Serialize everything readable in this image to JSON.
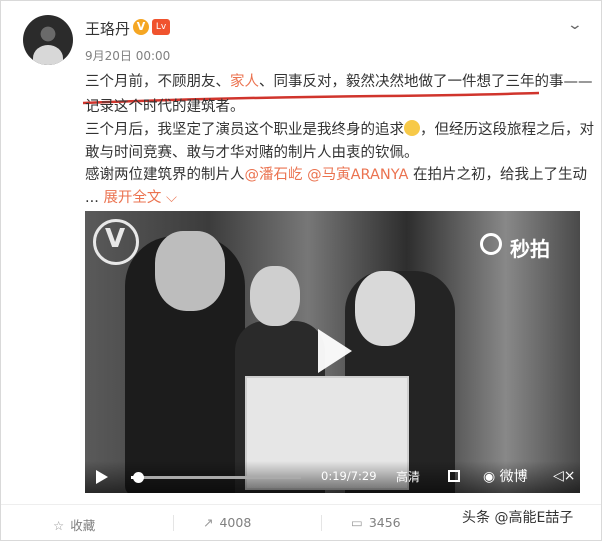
{
  "post": {
    "author": "王珞丹",
    "verified_badge": "V",
    "level_badge": "Lv",
    "time": "9月20日 00:00",
    "lines": [
      {
        "before": "三个月前，不顾朋友、",
        "highlight": "家人",
        "after": "、同事反对，毅然决然地做了一件想了三年的事——"
      },
      {
        "text": "记录这个时代的建筑者。"
      },
      {
        "text": "三个月后，我坚定了演员这个职业是我终身的追求",
        "after_emoji": "，但经历这段旅程之后，对"
      },
      {
        "text": "敢与时间竞赛、敢与才华对赌的制片人由衷的钦佩。"
      },
      {
        "before": "感谢两位建筑界的制片人",
        "mention1": "@潘石屹",
        "mention2": "@马寅ARANYA",
        "after": " 在拍片之初，给我上了生动"
      }
    ],
    "expand_dots": "...",
    "expand_label": "展开全文",
    "expand_arrow": "⌵"
  },
  "video": {
    "watermark": "秒拍",
    "time": "0:19/7:29",
    "quality": "高清",
    "weibo_label": "微博",
    "progress": 0.043,
    "icons": {
      "play": "play-icon",
      "fullscreen": "fullscreen-icon",
      "mute": "mute-icon"
    }
  },
  "footer": {
    "favorite_label": "收藏",
    "repost_count": "4008",
    "comment_count": "3456",
    "watermark": "头条 @高能E喆子"
  },
  "colors": {
    "highlight": "#eb7350",
    "underline": "#d0342c",
    "mention": "#eb7350"
  }
}
